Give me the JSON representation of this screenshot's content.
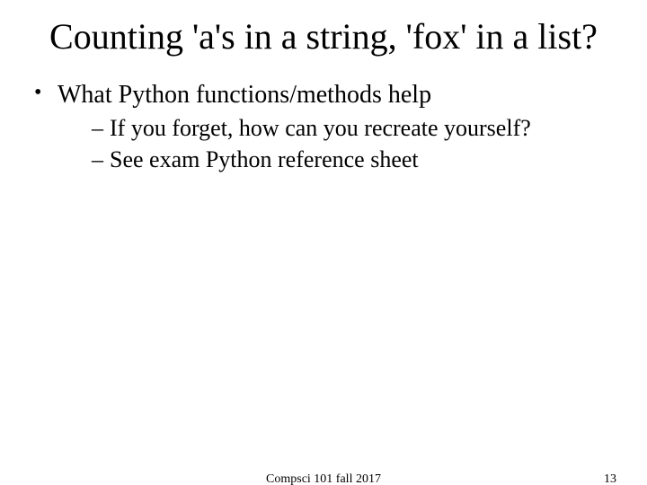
{
  "title": "Counting 'a's in a string, 'fox' in a list?",
  "bullets": [
    {
      "text": "What Python functions/methods help",
      "sub": [
        "If you forget, how can you recreate yourself?",
        "See exam Python reference sheet"
      ]
    }
  ],
  "footer": {
    "center": "Compsci 101 fall 2017",
    "page": "13"
  }
}
